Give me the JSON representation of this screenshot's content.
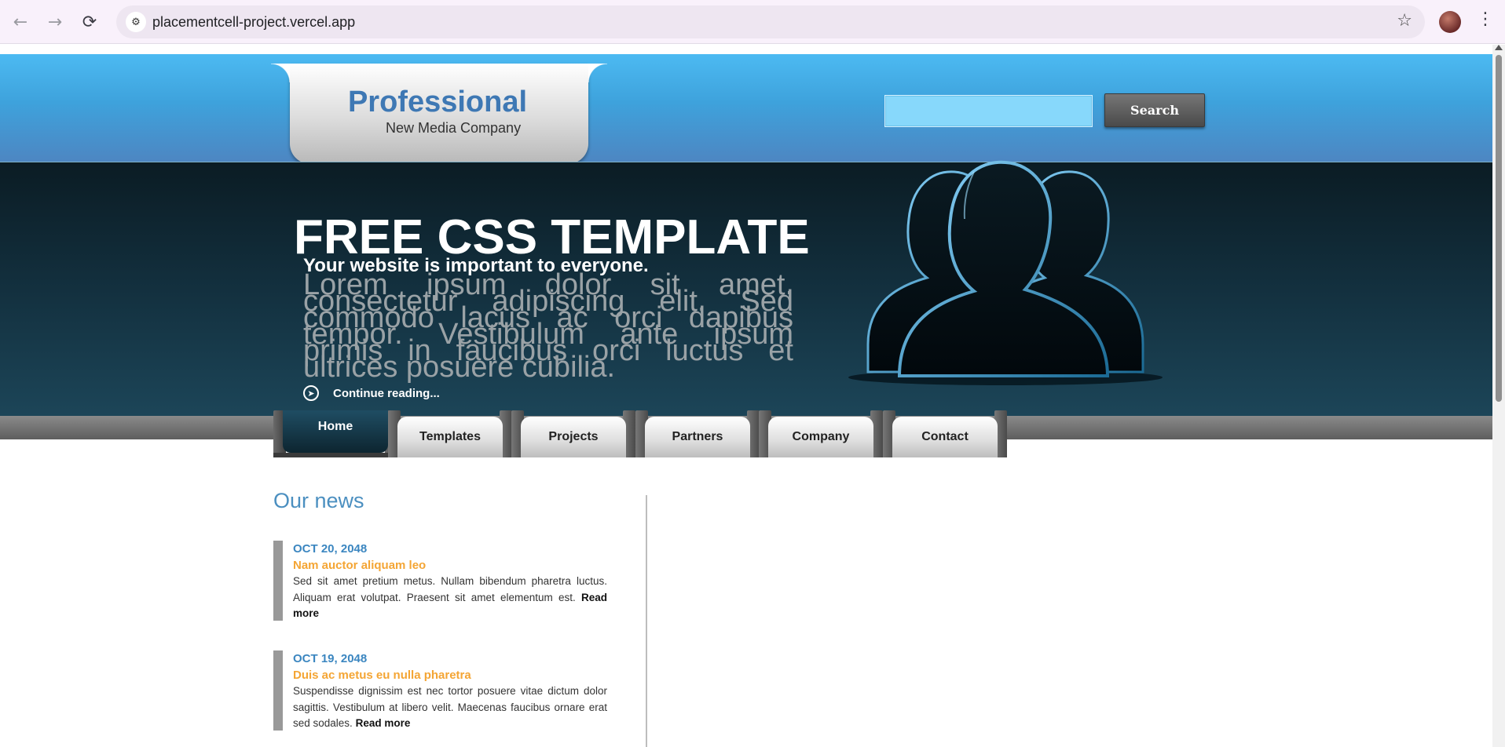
{
  "browser": {
    "url": "placementcell-project.vercel.app"
  },
  "header": {
    "logo_title": "Professional",
    "logo_subtitle": "New Media Company",
    "search_placeholder": "",
    "search_button": "Search"
  },
  "hero": {
    "title": "FREE CSS TEMPLATE",
    "subtitle": "Your website is important to everyone.",
    "body": "Lorem ipsum dolor sit amet, consectetur adipiscing elit. Sed commodo lacus ac orci dapibus tempor. Vestibulum ante ipsum primis in faucibus orci luctus et ultrices posuere cubilia.",
    "continue_label": "Continue reading..."
  },
  "nav": {
    "tabs": [
      {
        "label": "Home",
        "active": true
      },
      {
        "label": "Templates",
        "active": false
      },
      {
        "label": "Projects",
        "active": false
      },
      {
        "label": "Partners",
        "active": false
      },
      {
        "label": "Company",
        "active": false
      },
      {
        "label": "Contact",
        "active": false
      }
    ]
  },
  "news": {
    "title": "Our news",
    "items": [
      {
        "date": "OCT 20, 2048",
        "headline": "Nam auctor aliquam leo",
        "text": "Sed sit amet pretium metus. Nullam bibendum pharetra luctus. Aliquam erat volutpat. Praesent sit amet elementum est.",
        "more": "Read more"
      },
      {
        "date": "OCT 19, 2048",
        "headline": "Duis ac metus eu nulla pharetra",
        "text": "Suspendisse dignissim est nec tortor posuere vitae dictum dolor sagittis. Vestibulum at libero velit. Maecenas faucibus ornare erat sed sodales.",
        "more": "Read more"
      }
    ]
  },
  "colors": {
    "header_blue": "#4cbaf2",
    "logo_blue": "#3e78b4",
    "news_date_blue": "#3b86c0",
    "news_headline_orange": "#f4a534",
    "hero_dark": "#122e3c"
  },
  "icons": {
    "back": "arrow-left-icon",
    "forward": "arrow-right-icon",
    "reload": "reload-icon",
    "site_info": "tune-icon",
    "bookmark": "star-icon",
    "menu": "kebab-menu-icon",
    "continue": "arrow-circle-icon",
    "hero_graphic": "people-silhouette-icon"
  }
}
